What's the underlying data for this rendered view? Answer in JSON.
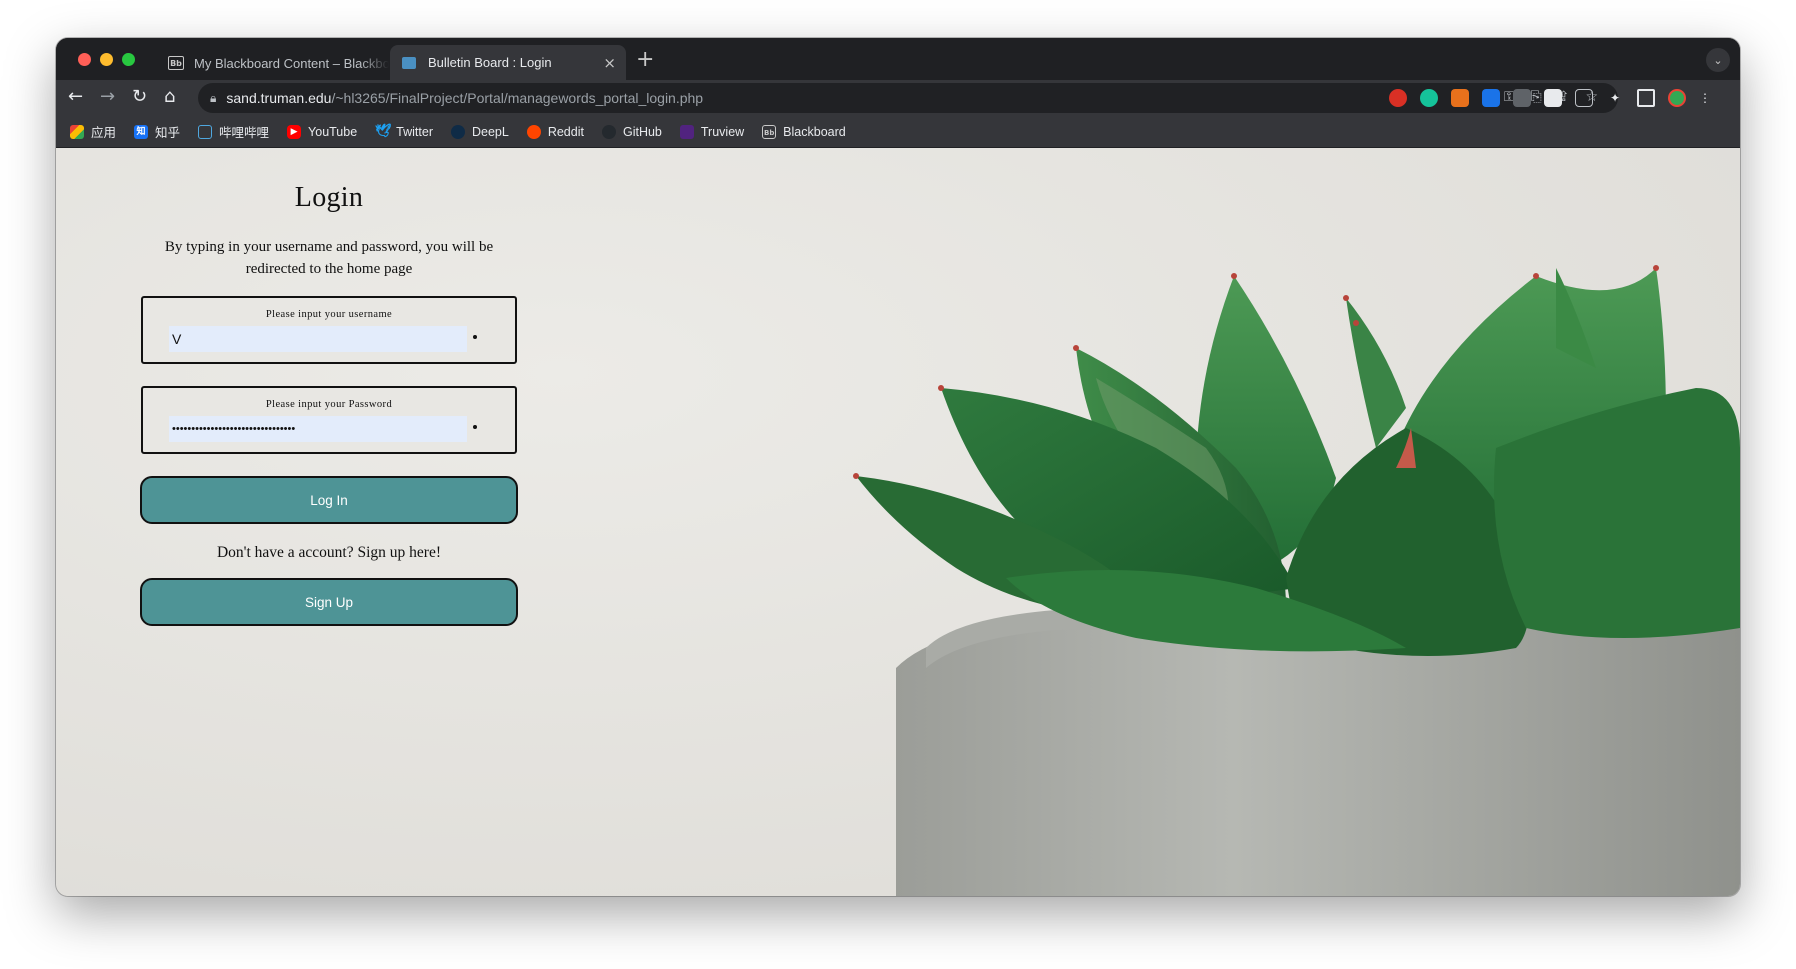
{
  "browser": {
    "tabs": [
      {
        "favicon": "Bb",
        "title": "My Blackboard Content – Blackboard",
        "close": "×"
      },
      {
        "title": "Bulletin Board : Login",
        "close": "×"
      }
    ],
    "new_tab": "+",
    "tab_menu": "⌄",
    "nav": {
      "back": "←",
      "forward": "→",
      "reload": "↻",
      "home": "⌂"
    },
    "url_host": "sand.truman.edu",
    "url_path": "/~hl3265/FinalProject/Portal/managewords_portal_login.php",
    "bookmarks": [
      {
        "label": "应用",
        "icon": "apps-grid-icon"
      },
      {
        "label": "知乎",
        "icon": "zhihu-icon"
      },
      {
        "label": "哔哩哔哩",
        "icon": "bilibili-icon"
      },
      {
        "label": "YouTube",
        "icon": "youtube-icon"
      },
      {
        "label": "Twitter",
        "icon": "twitter-icon"
      },
      {
        "label": "DeepL",
        "icon": "deepl-icon"
      },
      {
        "label": "Reddit",
        "icon": "reddit-icon"
      },
      {
        "label": "GitHub",
        "icon": "github-icon"
      },
      {
        "label": "Truview",
        "icon": "truview-icon"
      },
      {
        "label": "Blackboard",
        "icon": "blackboard-icon"
      }
    ]
  },
  "page": {
    "title": "Login",
    "description": "By typing in your username and password, you will be redirected to the home page",
    "username": {
      "label": "Please input your username",
      "value": "V"
    },
    "password": {
      "label": "Please input your Password",
      "value": "••••••••••••••••••••••••••••••••"
    },
    "login_button": "Log In",
    "signup_prompt": "Don't have a account? Sign up here!",
    "signup_button": "Sign Up"
  },
  "colors": {
    "button": "#4e9496",
    "page_bg": "#e6e5e1",
    "input_bg": "#e3ecfb"
  }
}
